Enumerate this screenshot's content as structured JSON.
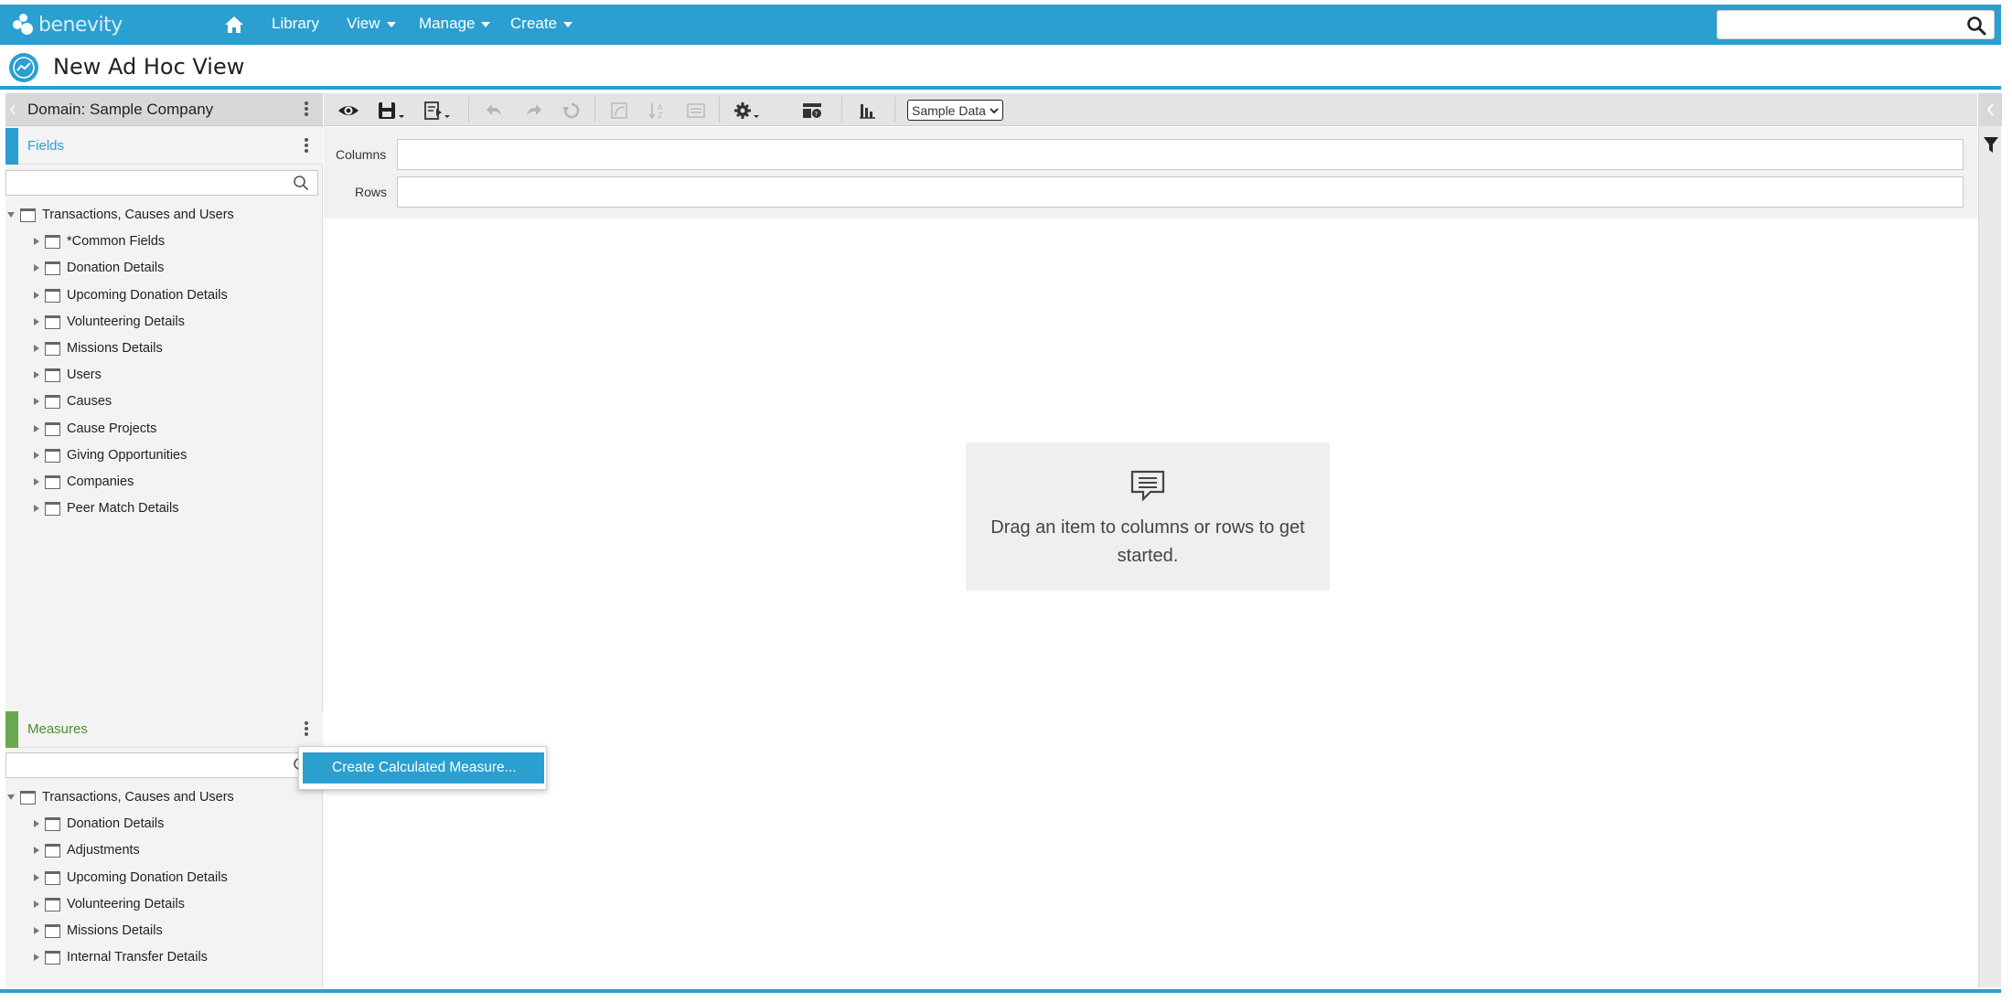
{
  "nav": {
    "brand": "benevity",
    "items": [
      "Library",
      "View",
      "Manage",
      "Create"
    ],
    "search_value": ""
  },
  "title": "New Ad Hoc View",
  "domain": {
    "label": "Domain: Sample Company"
  },
  "fields": {
    "header": "Fields",
    "search_value": "",
    "root": "Transactions, Causes and Users",
    "items": [
      "*Common Fields",
      "Donation Details",
      "Upcoming Donation Details",
      "Volunteering Details",
      "Missions Details",
      "Users",
      "Causes",
      "Cause Projects",
      "Giving Opportunities",
      "Companies",
      "Peer Match Details"
    ]
  },
  "measures": {
    "header": "Measures",
    "search_value": "",
    "root": "Transactions, Causes and Users",
    "items": [
      "Donation Details",
      "Adjustments",
      "Upcoming Donation Details",
      "Volunteering Details",
      "Missions Details",
      "Internal Transfer Details"
    ]
  },
  "toolbar": {
    "data_select": "Sample Data"
  },
  "dropzones": {
    "columns_label": "Columns",
    "rows_label": "Rows"
  },
  "empty_state": {
    "message": "Drag an item to columns or rows to get started."
  },
  "context_menu": {
    "item": "Create Calculated Measure..."
  },
  "colors": {
    "accent": "#2a9fd0",
    "fields_stripe": "#2a9fd0",
    "measures_stripe": "#6aa84f",
    "measures_text": "#4d8c2a"
  }
}
